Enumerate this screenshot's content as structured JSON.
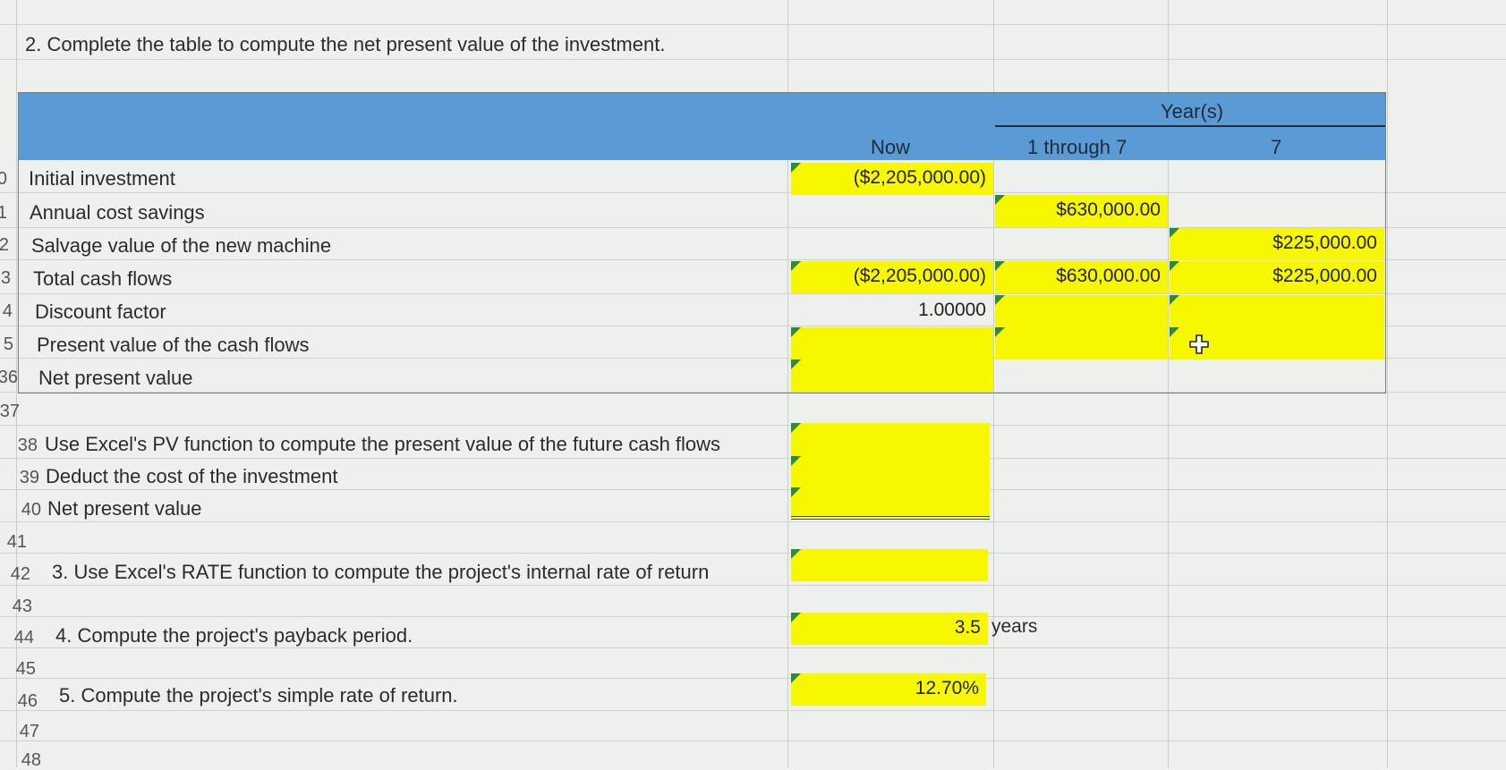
{
  "question2": "2. Complete the table to compute the net present value of the investment.",
  "table": {
    "header": {
      "years_label": "Year(s)",
      "col_now": "Now",
      "col_1_7": "1 through 7",
      "col_7": "7"
    },
    "rows": [
      {
        "num": "0",
        "label": "Initial investment",
        "now": "($2,205,000.00)",
        "y17": "",
        "y7": ""
      },
      {
        "num": "1",
        "label": "Annual cost savings",
        "now": "",
        "y17": "$630,000.00",
        "y7": ""
      },
      {
        "num": "2",
        "label": "Salvage value of the new machine",
        "now": "",
        "y17": "",
        "y7": "$225,000.00"
      },
      {
        "num": "3",
        "label": "Total cash flows",
        "now": "($2,205,000.00)",
        "y17": "$630,000.00",
        "y7": "$225,000.00"
      },
      {
        "num": "4",
        "label": "Discount factor",
        "now": "1.00000",
        "y17": "",
        "y7": ""
      },
      {
        "num": "5",
        "label": "Present value of the cash flows",
        "now": "",
        "y17": "",
        "y7": ""
      },
      {
        "num": "36",
        "label": "Net present value",
        "now": "",
        "y17": "",
        "y7": ""
      }
    ]
  },
  "row37": "37",
  "pv_section": [
    {
      "num": "38",
      "label": "Use Excel's PV function to compute the present value of the future cash flows",
      "value": ""
    },
    {
      "num": "39",
      "label": "Deduct the cost of the investment",
      "value": ""
    },
    {
      "num": "40",
      "label": "Net present value",
      "value": ""
    }
  ],
  "row41": "41",
  "q3": {
    "num": "42",
    "label": "3. Use Excel's RATE function to compute the project's internal rate of return",
    "value": ""
  },
  "row43": "43",
  "q4": {
    "num": "44",
    "label": "4. Compute the project's payback period.",
    "value": "3.5",
    "unit": "years"
  },
  "row45": "45",
  "q5": {
    "num": "46",
    "label": "5. Compute the project's simple rate of return.",
    "value": "12.70%"
  },
  "row47": "47",
  "row48": "48",
  "colors": {
    "yellow": "#f7f700",
    "header_blue": "#5b9bd5",
    "marker_green": "#2e8b3e"
  }
}
